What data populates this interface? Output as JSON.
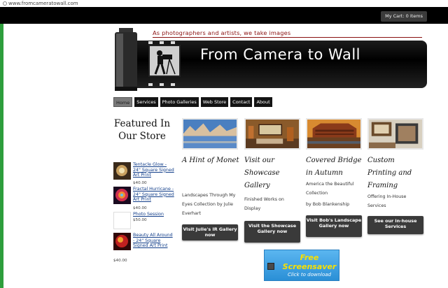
{
  "browser": {
    "url": "www.fromcameratowall.com"
  },
  "header": {
    "cart_label": "My Cart: 0 Items",
    "tagline": "As photographers and artists, we take images",
    "site_title": "From Camera to Wall"
  },
  "nav": {
    "items": [
      {
        "label": "Home"
      },
      {
        "label": "Services"
      },
      {
        "label": "Photo Galleries"
      },
      {
        "label": "Web Store"
      },
      {
        "label": "Contact"
      },
      {
        "label": "About"
      }
    ],
    "active": "Home"
  },
  "sidebar": {
    "title": "Featured In Our Store",
    "products": [
      {
        "name": "Tentacle Glow - 24\" Square Signed Art Print",
        "price": "$40.00"
      },
      {
        "name": "Fractal Hurricane - 24\" Square Signed Art Print",
        "price": "$40.00"
      },
      {
        "name": "Photo Session",
        "price": "$50.00"
      },
      {
        "name": "Beauty All Around - 24\" Square Signed Art Print",
        "price": "$40.00"
      }
    ]
  },
  "columns": [
    {
      "heading": "A Hint of Monet",
      "desc": "Landscapes Through My Eyes Collection by Julie Everhart",
      "button": "Visit Julie's IR Gallery now"
    },
    {
      "heading": "Visit our Showcase Gallery",
      "desc": "Finished Works on Display",
      "button": "Visit the Showcase Gallery now"
    },
    {
      "heading": "Covered Bridge in Autumn",
      "desc1": "America the Beautiful Collection",
      "desc2": "by Bob Blankenship",
      "button": "Visit Bob's Landscape Gallery now"
    },
    {
      "heading": "Custom Printing and Framing",
      "desc": "Offering In-House Services",
      "button": "See our in-house Services"
    }
  ],
  "screensaver": {
    "line1": "Free",
    "line2": "Screensaver",
    "line3": "Click to download"
  },
  "colors": {
    "top_bar": "#000000",
    "accent_red": "#8a1010",
    "link_blue": "#123e8a",
    "button_dark": "#3a3a3a",
    "screensaver_blue": "#2a8fd6",
    "screensaver_text": "#f8e000"
  }
}
